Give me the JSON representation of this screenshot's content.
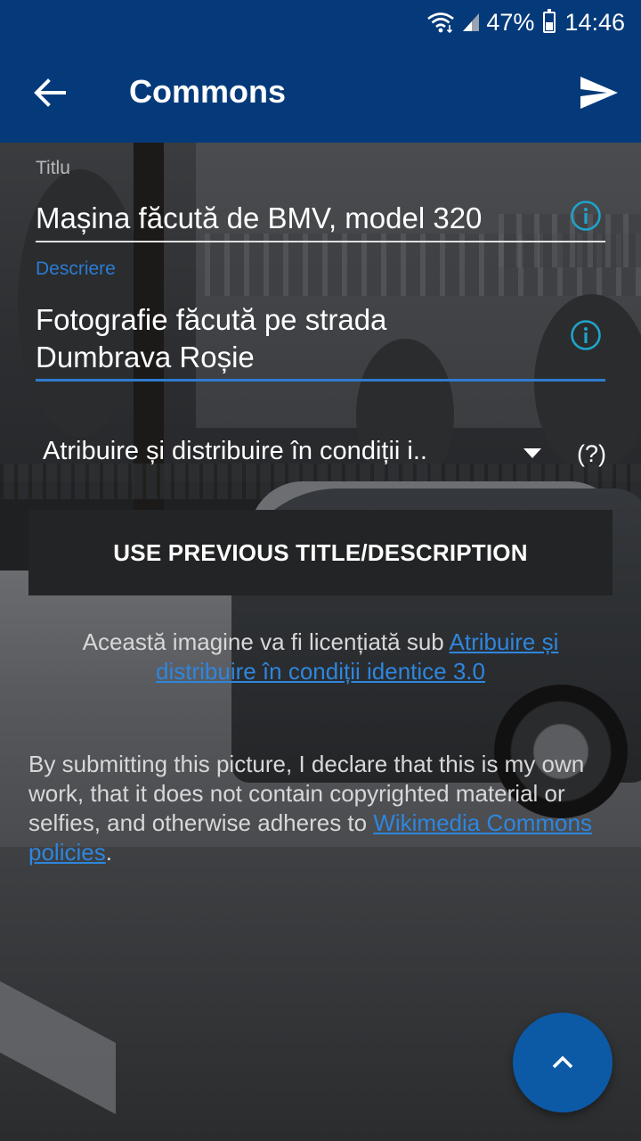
{
  "status_bar": {
    "battery_percent": "47%",
    "battery_level": 0.47,
    "time": "14:46",
    "icons": [
      "wifi-icon",
      "signal-icon",
      "battery-icon"
    ]
  },
  "app_bar": {
    "title": "Commons",
    "back_icon": "arrow-back-icon",
    "send_icon": "send-icon"
  },
  "form": {
    "title_label": "Titlu",
    "title_value": "Mașina făcută de BMV, model 320",
    "description_label": "Descriere",
    "description_line1": "Fotografie făcută pe strada",
    "description_line2": "Dumbrava Roșie",
    "license_selected": "Atribuire și distribuire în condiții i..",
    "help": "(?)",
    "previous_button": "USE PREVIOUS TITLE/DESCRIPTION"
  },
  "license_note": {
    "prefix": "Această imagine va fi licențiată sub ",
    "link": "Atribuire și distribuire în condiții identice 3.0"
  },
  "declaration": {
    "text": "By submitting this picture, I declare that this is my own work, that it does not contain copyrighted material or selfies, and otherwise adheres to ",
    "link": "Wikimedia Commons policies",
    "suffix": "."
  },
  "colors": {
    "app_bar": "#053a7a",
    "accent": "#2f7bd0",
    "link": "#2e86de",
    "info_icon": "#1fa3c9",
    "fab": "#0c5aa6"
  }
}
